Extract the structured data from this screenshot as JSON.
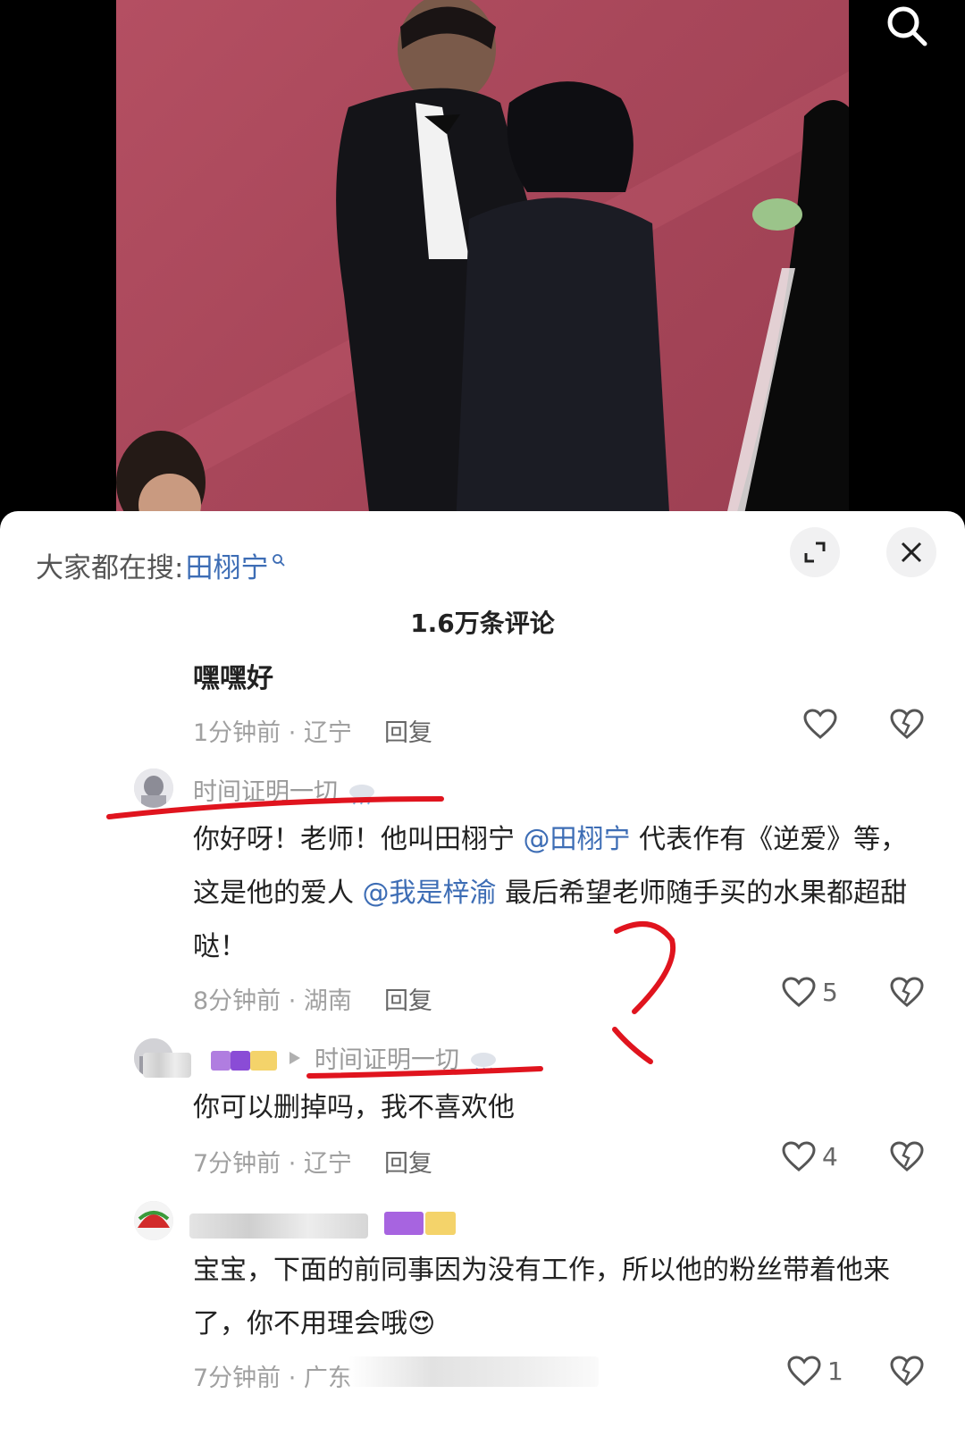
{
  "sheet": {
    "trending_prefix": "大家都在搜:",
    "trending_keyword": "田栩宁",
    "comment_count": "1.6万条评论"
  },
  "comments": [
    {
      "text": "嘿嘿好",
      "time_location": "1分钟前 · 辽宁",
      "reply_label": "回复",
      "likes": ""
    },
    {
      "username": "时间证明一切",
      "text_parts": [
        "你好呀！老师！他叫田栩宁 ",
        "@田栩宁",
        " 代表作有《逆爱》等，这是他的爱人 ",
        "@我是梓渝",
        " 最后希望老师随手买的水果都超甜哒！"
      ],
      "time_location": "8分钟前 · 湖南",
      "reply_label": "回复",
      "likes": "5"
    },
    {
      "reply_to": "时间证明一切",
      "text": "你可以删掉吗，我不喜欢他",
      "time_location": "7分钟前 · 辽宁",
      "reply_label": "回复",
      "likes": "4"
    },
    {
      "text": "宝宝，下面的前同事因为没有工作，所以他的粉丝带着他来了，你不用理会哦",
      "emoji": "😍",
      "time_location": "7分钟前 · 广东",
      "likes": "1"
    }
  ],
  "icons": {
    "search": "search-icon",
    "expand": "expand-icon",
    "close": "close-icon",
    "like": "heart-icon",
    "dislike": "broken-heart-icon",
    "reply_arrow": "triangle-right-icon",
    "weather": "cloud-rain-icon"
  },
  "colors": {
    "mention": "#3d6db5",
    "annotation": "#e0141e",
    "carpet": "#a8475a"
  }
}
